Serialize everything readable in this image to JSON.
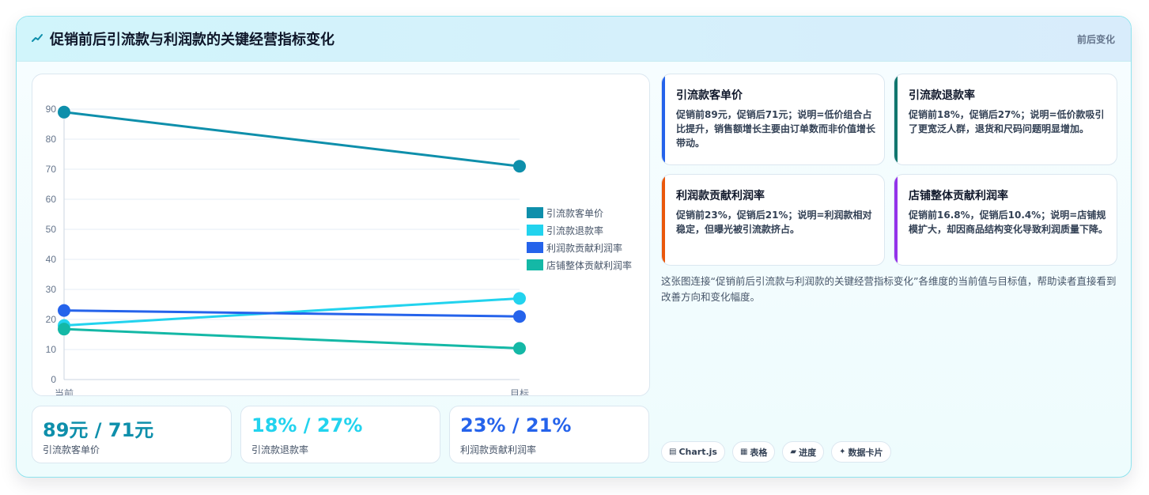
{
  "header": {
    "title": "促销前后引流款与利润款的关键经营指标变化",
    "tag": "前后变化",
    "icon": "trend-icon"
  },
  "colors": {
    "series": [
      "#0e8fab",
      "#22d3ee",
      "#2563eb",
      "#14b8a6"
    ],
    "note_bars": [
      "#2563eb",
      "#0f766e",
      "#ea580c",
      "#9333ea"
    ]
  },
  "chart_data": {
    "type": "line",
    "categories": [
      "当前",
      "目标"
    ],
    "ylim": [
      0,
      90
    ],
    "yticks": [
      0,
      10,
      20,
      30,
      40,
      50,
      60,
      70,
      80,
      90
    ],
    "grid": true,
    "legend_position": "right",
    "series": [
      {
        "name": "引流款客单价",
        "values": [
          89,
          71
        ]
      },
      {
        "name": "引流款退款率",
        "values": [
          18,
          27
        ]
      },
      {
        "name": "利润款贡献利润率",
        "values": [
          23,
          21
        ]
      },
      {
        "name": "店铺整体贡献利润率",
        "values": [
          16.8,
          10.4
        ]
      }
    ]
  },
  "stats": [
    {
      "value": "89元 / 71元",
      "label": "引流款客单价",
      "color": "#0e8fab"
    },
    {
      "value": "18% / 27%",
      "label": "引流款退款率",
      "color": "#22d3ee"
    },
    {
      "value": "23% / 21%",
      "label": "利润款贡献利润率",
      "color": "#2563eb"
    }
  ],
  "notes": [
    {
      "title": "引流款客单价",
      "text": "促销前89元，促销后71元；说明=低价组合占比提升，销售额增长主要由订单数而非价值增长带动。"
    },
    {
      "title": "引流款退款率",
      "text": "促销前18%，促销后27%；说明=低价款吸引了更宽泛人群，退货和尺码问题明显增加。"
    },
    {
      "title": "利润款贡献利润率",
      "text": "促销前23%，促销后21%；说明=利润款相对稳定，但曝光被引流款挤占。"
    },
    {
      "title": "店铺整体贡献利润率",
      "text": "促销前16.8%，促销后10.4%；说明=店铺规模扩大，却因商品结构变化导致利润质量下降。"
    }
  ],
  "description": "这张图连接“促销前后引流款与利润款的关键经营指标变化”各维度的当前值与目标值，帮助读者直接看到改善方向和变化幅度。",
  "chips": [
    {
      "icon": "▤",
      "label": "Chart.js"
    },
    {
      "icon": "▦",
      "label": "表格"
    },
    {
      "icon": "▰",
      "label": "进度"
    },
    {
      "icon": "✦",
      "label": "数据卡片"
    }
  ]
}
